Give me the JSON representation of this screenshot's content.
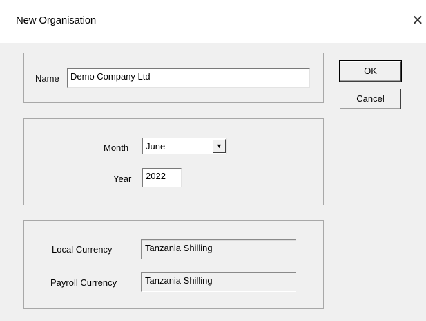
{
  "window": {
    "title": "New Organisation",
    "close_symbol": "✕"
  },
  "name_group": {
    "label": "Name",
    "value": "Demo Company Ltd"
  },
  "period_group": {
    "month_label": "Month",
    "month_value": "June",
    "year_label": "Year",
    "year_value": "2022",
    "dropdown_arrow": "▼"
  },
  "currency_group": {
    "local_label": "Local Currency",
    "local_value": "Tanzania Shilling",
    "payroll_label": "Payroll Currency",
    "payroll_value": "Tanzania Shilling"
  },
  "buttons": {
    "ok": "OK",
    "cancel": "Cancel"
  }
}
